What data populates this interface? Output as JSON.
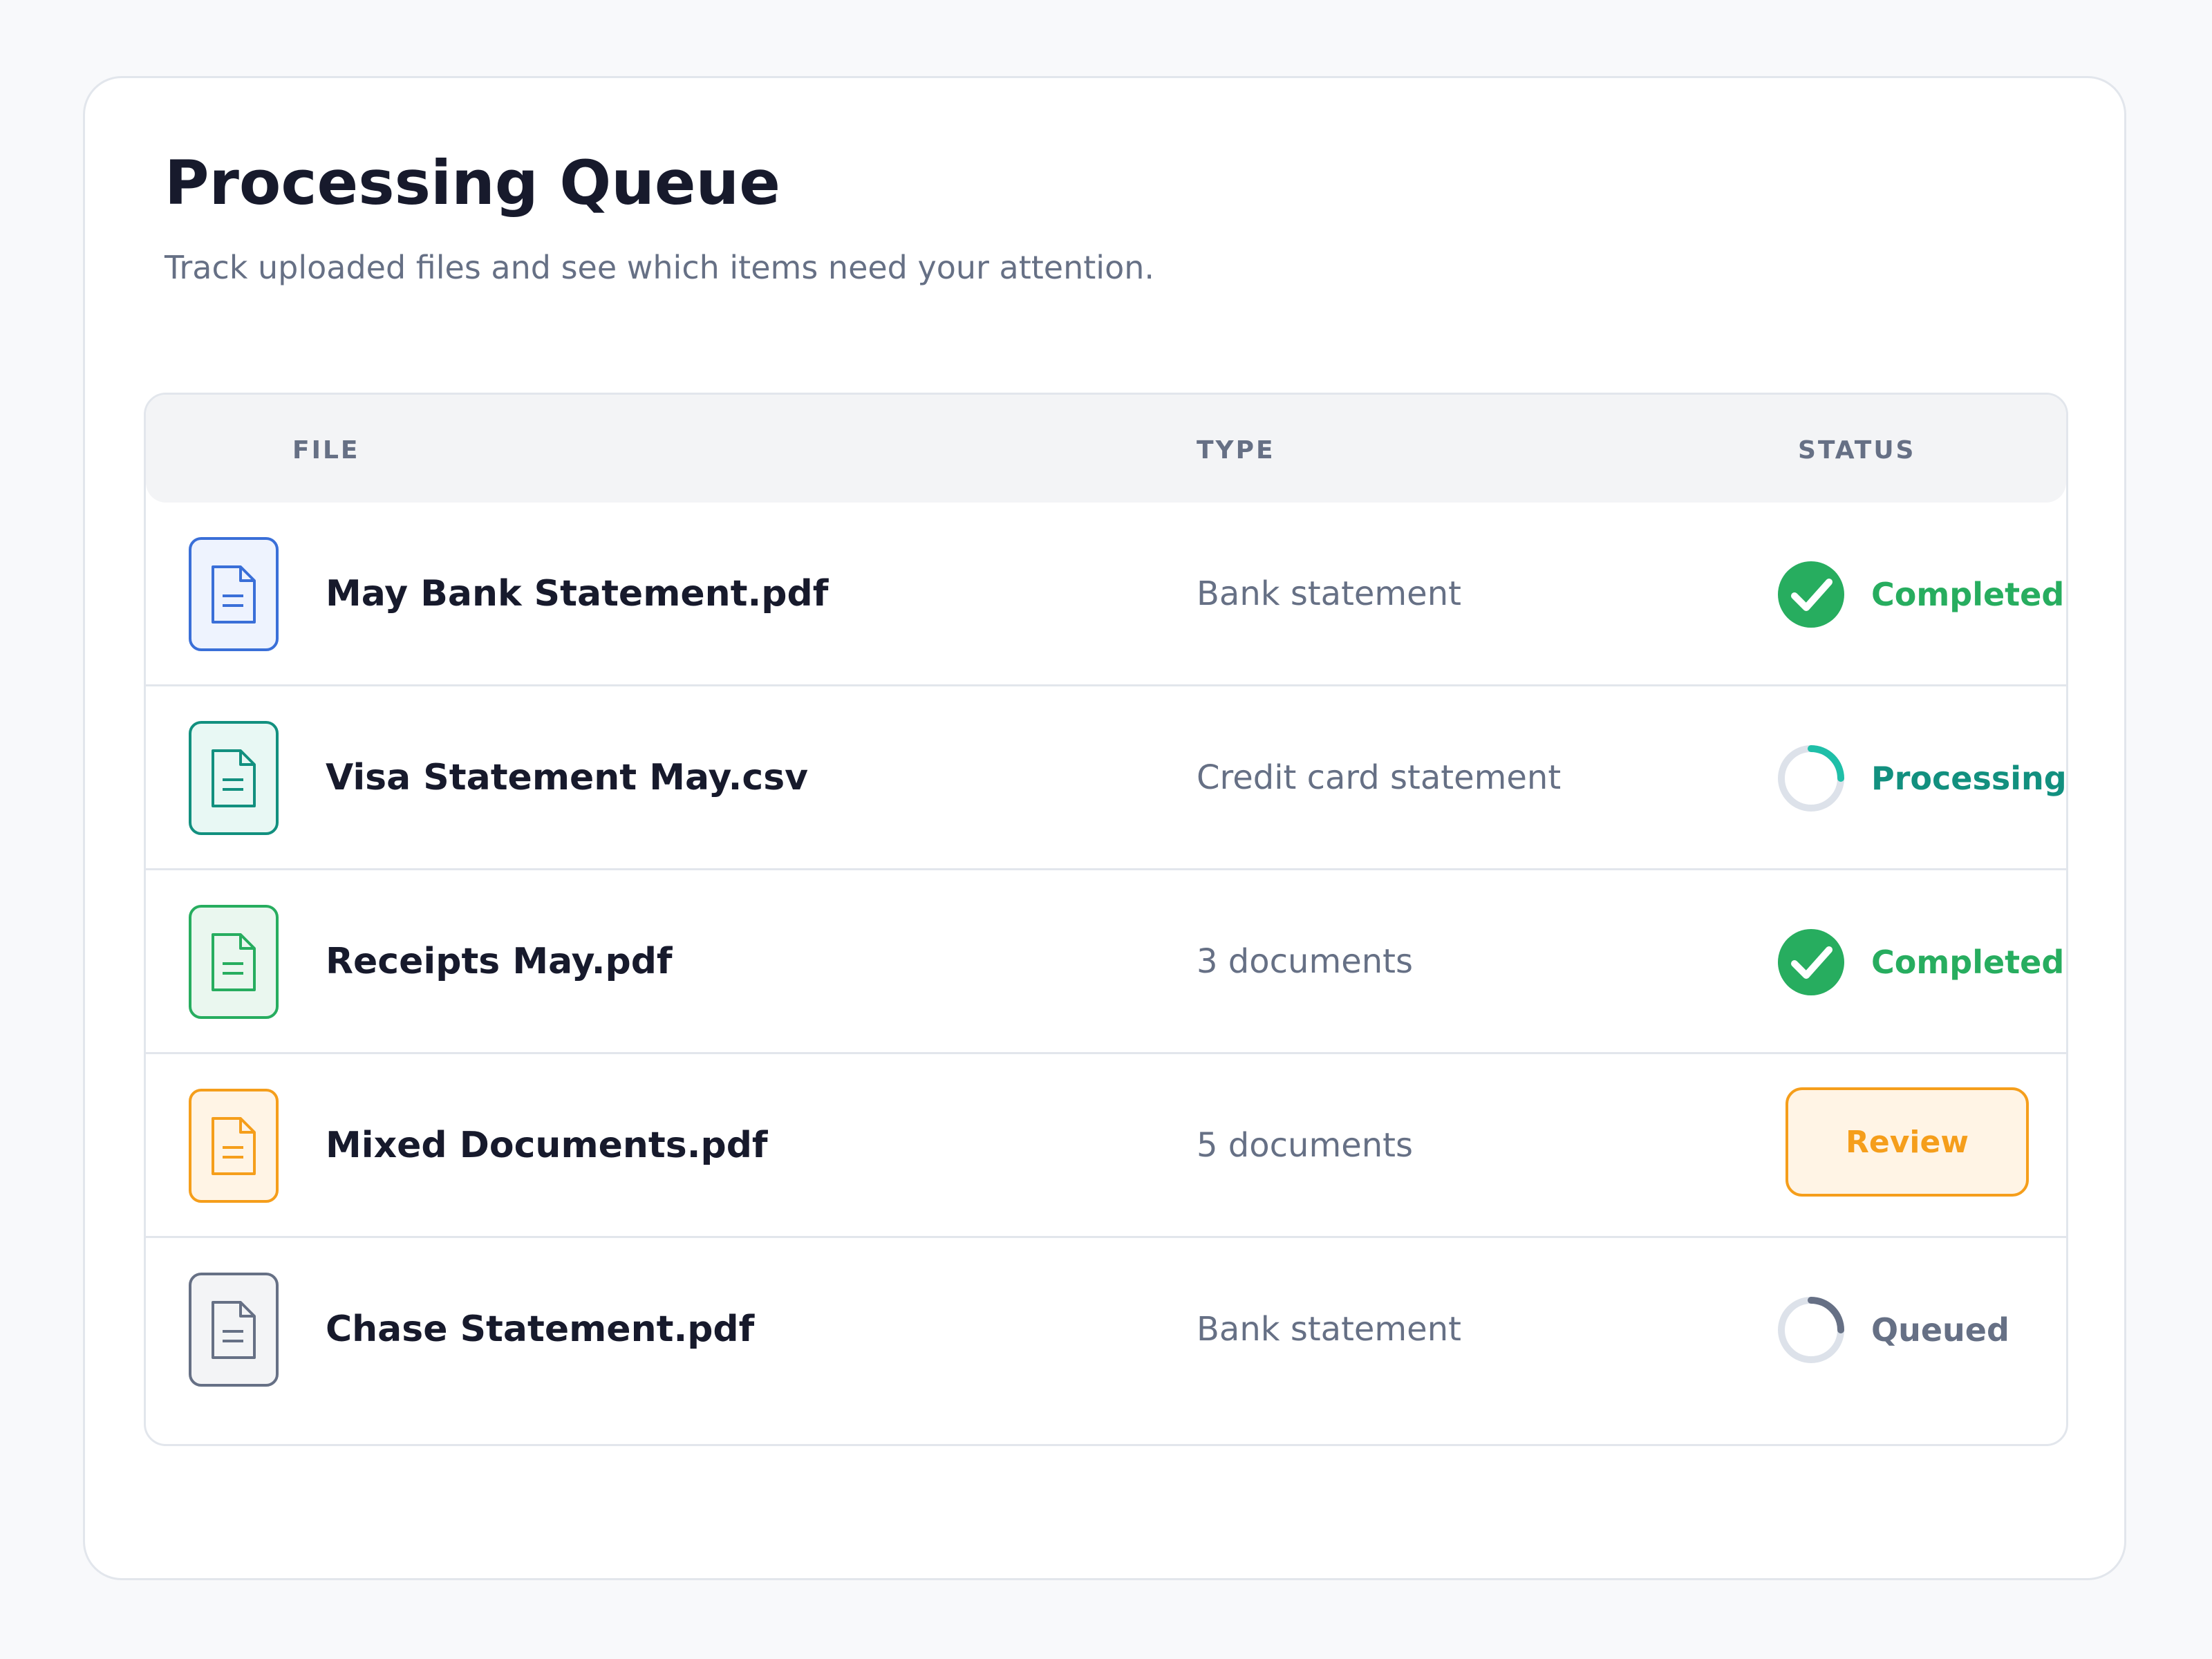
{
  "header": {
    "title": "Processing Queue",
    "subtitle": "Track uploaded files and see which items need your attention."
  },
  "table": {
    "columns": [
      "FILE",
      "TYPE",
      "STATUS"
    ],
    "rows": [
      {
        "file": "May Bank Statement.pdf",
        "type": "Bank statement",
        "status": "Completed",
        "icon": "file-icon",
        "color": "#3a6fd8",
        "bg": "#eef3fe"
      },
      {
        "file": "Visa Statement May.csv",
        "type": "Credit card statement",
        "status": "Processing",
        "icon": "file-icon",
        "color": "#12907f",
        "bg": "#e8f8f4"
      },
      {
        "file": "Receipts May.pdf",
        "type": "3 documents",
        "status": "Completed",
        "icon": "file-icon",
        "color": "#27ad5f",
        "bg": "#eaf7ef"
      },
      {
        "file": "Mixed Documents.pdf",
        "type": "5 documents",
        "status": "Review",
        "icon": "file-icon",
        "color": "#f59e1b",
        "bg": "#fff4e5"
      },
      {
        "file": "Chase Statement.pdf",
        "type": "Bank statement",
        "status": "Queued",
        "icon": "file-icon",
        "color": "#667085",
        "bg": "#f3f4f6"
      }
    ]
  },
  "status_colors": {
    "completed": "#27ad5f",
    "processing": "#12907f",
    "processing_arc": "#1fbfa8",
    "review": "#f59e1b",
    "queued": "#667085",
    "track": "#dde2ea"
  }
}
